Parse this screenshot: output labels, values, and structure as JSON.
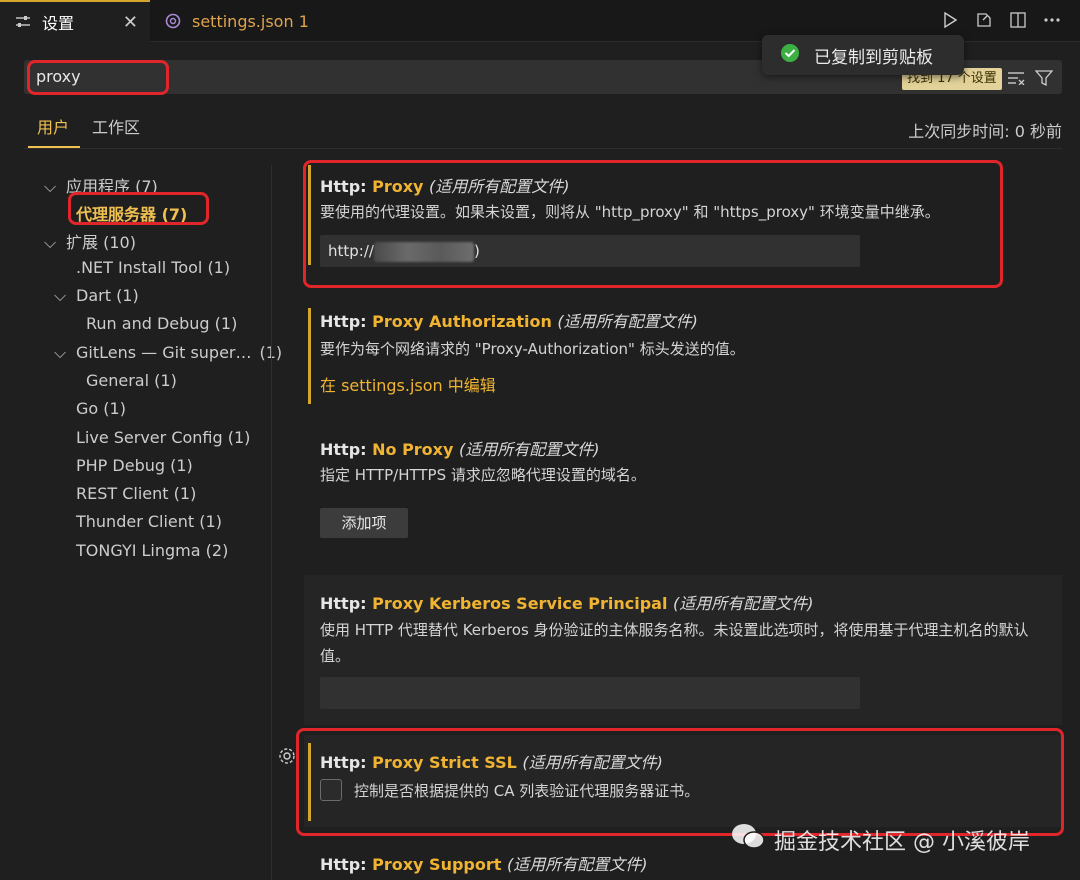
{
  "tabs": {
    "active_label": "设置",
    "inactive_label": "settings.json 1",
    "close_glyph": "✕"
  },
  "toast": {
    "message": "已复制到剪贴板",
    "accent": "#3cb043"
  },
  "search": {
    "value": "proxy",
    "found": "找到 17 个设置"
  },
  "scope": {
    "user": "用户",
    "workspace": "工作区",
    "sync": "上次同步时间: 0 秒前"
  },
  "toc": [
    {
      "label": "应用程序 (7)",
      "chev": "⌵"
    },
    {
      "label": "代理服务器 (7)",
      "chev": ""
    },
    {
      "label": "扩展 (10)",
      "chev": "⌵"
    },
    {
      "label": ".NET Install Tool (1)",
      "chev": ""
    },
    {
      "label": "Dart (1)",
      "chev": "⌵"
    },
    {
      "label": "Run and Debug (1)",
      "chev": ""
    },
    {
      "label": "GitLens — Git super…",
      "chev": "⌵",
      "count": "(1)"
    },
    {
      "label": "General (1)",
      "chev": ""
    },
    {
      "label": "Go (1)",
      "chev": ""
    },
    {
      "label": "Live Server Config (1)",
      "chev": ""
    },
    {
      "label": "PHP Debug (1)",
      "chev": ""
    },
    {
      "label": "REST Client (1)",
      "chev": ""
    },
    {
      "label": "Thunder Client (1)",
      "chev": ""
    },
    {
      "label": "TONGYI Lingma (2)",
      "chev": ""
    }
  ],
  "settings": {
    "proxy": {
      "prefix": "Http: ",
      "key": "Proxy",
      "scope": "(适用所有配置文件)",
      "desc": "要使用的代理设置。如果未设置，则将从 \"http_proxy\" 和 \"https_proxy\" 环境变量中继承。",
      "value_start": "http://",
      "value_end": ")"
    },
    "auth": {
      "prefix": "Http: ",
      "key": "Proxy Authorization",
      "scope": "(适用所有配置文件)",
      "desc": "要作为每个网络请求的 \"Proxy-Authorization\" 标头发送的值。",
      "link": "在 settings.json 中编辑"
    },
    "noproxy": {
      "prefix": "Http: ",
      "key": "No Proxy",
      "scope": "(适用所有配置文件)",
      "desc": "指定 HTTP/HTTPS 请求应忽略代理设置的域名。",
      "button": "添加项"
    },
    "kerberos": {
      "prefix": "Http: ",
      "key": "Proxy Kerberos Service Principal",
      "scope": "(适用所有配置文件)",
      "desc": "使用 HTTP 代理替代 Kerberos 身份验证的主体服务名称。未设置此选项时，将使用基于代理主机名的默认值。"
    },
    "ssl": {
      "prefix": "Http: ",
      "key": "Proxy Strict SSL",
      "scope": "(适用所有配置文件)",
      "desc": "控制是否根据提供的 CA 列表验证代理服务器证书。"
    },
    "support": {
      "prefix": "Http: ",
      "key": "Proxy Support",
      "scope": "(适用所有配置文件)"
    }
  },
  "watermark": {
    "text": "掘金技术社区 @ 小溪彼岸"
  },
  "colors": {
    "accent": "#f0b432",
    "highlight_box": "#e0262a",
    "background": "#1f1f1f"
  }
}
